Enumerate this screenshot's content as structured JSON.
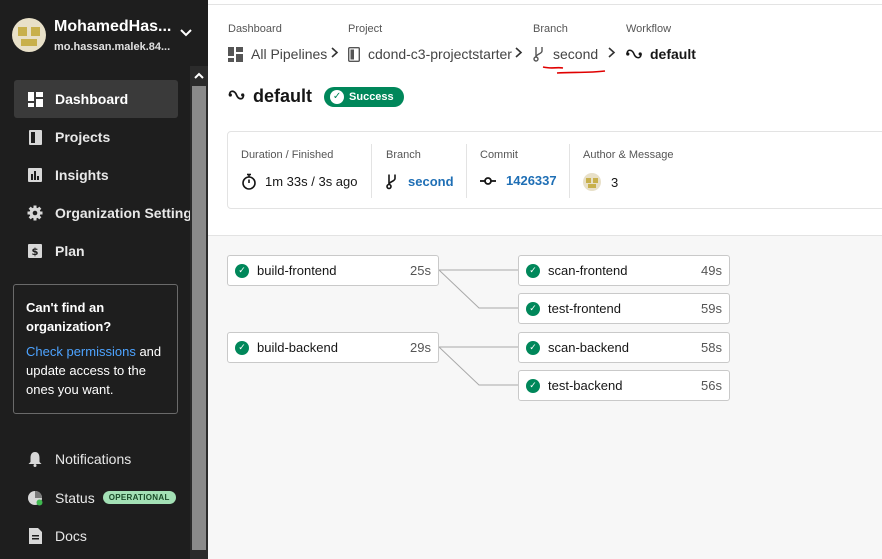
{
  "user": {
    "name": "MohamedHas...",
    "email": "mo.hassan.malek.84..."
  },
  "nav": [
    {
      "label": "Dashboard",
      "icon": "dashboard-icon",
      "active": true
    },
    {
      "label": "Projects",
      "icon": "projects-icon"
    },
    {
      "label": "Insights",
      "icon": "insights-icon"
    },
    {
      "label": "Organization Settings",
      "icon": "gear-icon"
    },
    {
      "label": "Plan",
      "icon": "plan-icon"
    }
  ],
  "org_box": {
    "title": "Can't find an organization?",
    "link": "Check permissions",
    "text": " and update access to the ones you want."
  },
  "bottom_nav": [
    {
      "label": "Notifications",
      "icon": "bell-icon"
    },
    {
      "label": "Status",
      "icon": "status-icon",
      "badge": "OPERATIONAL"
    },
    {
      "label": "Docs",
      "icon": "docs-icon"
    }
  ],
  "breadcrumb": {
    "dashboard": {
      "label": "Dashboard",
      "value": "All Pipelines"
    },
    "project": {
      "label": "Project",
      "value": "cdond-c3-projectstarter"
    },
    "branch": {
      "label": "Branch",
      "value": "second"
    },
    "workflow": {
      "label": "Workflow",
      "value": "default"
    }
  },
  "workflow": {
    "name": "default",
    "status": "Success"
  },
  "summary": {
    "duration_label": "Duration / Finished",
    "duration_value": "1m 33s / 3s ago",
    "branch_label": "Branch",
    "branch_value": "second",
    "commit_label": "Commit",
    "commit_value": "1426337",
    "author_label": "Author & Message",
    "author_value": "3"
  },
  "jobs": [
    {
      "name": "build-frontend",
      "duration": "25s"
    },
    {
      "name": "scan-frontend",
      "duration": "49s"
    },
    {
      "name": "test-frontend",
      "duration": "59s"
    },
    {
      "name": "build-backend",
      "duration": "29s"
    },
    {
      "name": "scan-backend",
      "duration": "58s"
    },
    {
      "name": "test-backend",
      "duration": "56s"
    }
  ],
  "colors": {
    "success": "#00875a",
    "link": "#1f6fb5",
    "sidebar": "#1e1e1e"
  }
}
